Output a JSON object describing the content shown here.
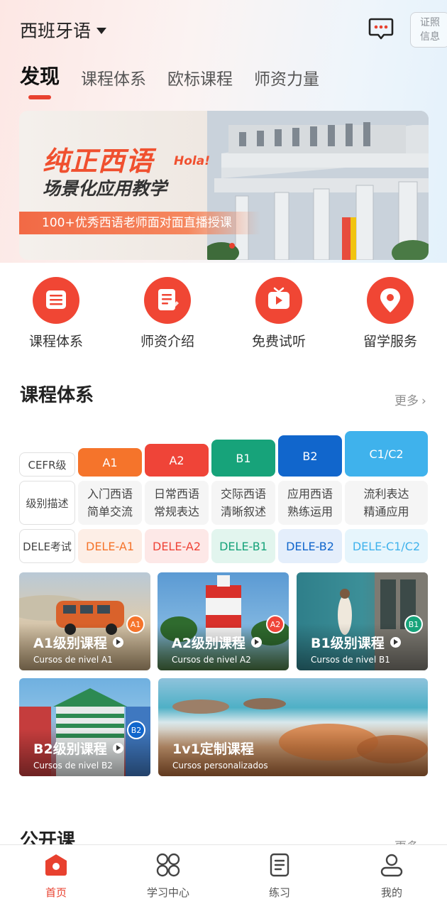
{
  "header": {
    "language": "西班牙语",
    "cert_line1": "证照",
    "cert_line2": "信息"
  },
  "tabs": [
    {
      "label": "发现",
      "active": true
    },
    {
      "label": "课程体系"
    },
    {
      "label": "欧标课程"
    },
    {
      "label": "师资力量"
    }
  ],
  "banner": {
    "title": "纯正西语",
    "hola": "Hola!",
    "subtitle": "场景化应用教学",
    "strip": "100+优秀西语老师面对面直播授课"
  },
  "quick_entries": [
    {
      "label": "课程体系",
      "icon": "list-icon"
    },
    {
      "label": "师资介绍",
      "icon": "document-icon"
    },
    {
      "label": "免费试听",
      "icon": "tv-play-icon"
    },
    {
      "label": "留学服务",
      "icon": "location-pin-icon"
    }
  ],
  "course_section": {
    "title": "课程体系",
    "more": "更多"
  },
  "level_table": {
    "row_labels": [
      "CEFR级",
      "级别描述",
      "DELE考试"
    ],
    "levels": [
      {
        "name": "A1",
        "desc1": "入门西语",
        "desc2": "简单交流",
        "dele": "DELE-A1",
        "color": "#f5742b"
      },
      {
        "name": "A2",
        "desc1": "日常西语",
        "desc2": "常规表达",
        "dele": "DELE-A2",
        "color": "#ef4438"
      },
      {
        "name": "B1",
        "desc1": "交际西语",
        "desc2": "清晰叙述",
        "dele": "DELE-B1",
        "color": "#17a37a"
      },
      {
        "name": "B2",
        "desc1": "应用西语",
        "desc2": "熟练运用",
        "dele": "DELE-B2",
        "color": "#1166cc"
      },
      {
        "name": "C1/C2",
        "desc1": "流利表达",
        "desc2": "精通应用",
        "dele": "DELE-C1/C2",
        "color": "#3fb2ec"
      }
    ]
  },
  "course_cards": [
    {
      "title": "A1级别课程",
      "subtitle": "Cursos de nivel A1",
      "badge": "A1"
    },
    {
      "title": "A2级别课程",
      "subtitle": "Cursos de nivel A2",
      "badge": "A2"
    },
    {
      "title": "B1级别课程",
      "subtitle": "Cursos de nivel B1",
      "badge": "B1"
    },
    {
      "title": "B2级别课程",
      "subtitle": "Cursos de nivel B2",
      "badge": "B2"
    },
    {
      "title": "1v1定制课程",
      "subtitle": "Cursos personalizados"
    }
  ],
  "public_section": {
    "title": "公开课",
    "more": "更多"
  },
  "tabbar": [
    {
      "label": "首页",
      "icon": "home-icon",
      "active": true
    },
    {
      "label": "学习中心",
      "icon": "grid-icon"
    },
    {
      "label": "练习",
      "icon": "notes-icon"
    },
    {
      "label": "我的",
      "icon": "user-icon"
    }
  ],
  "colors": {
    "accent": "#e8412f"
  }
}
